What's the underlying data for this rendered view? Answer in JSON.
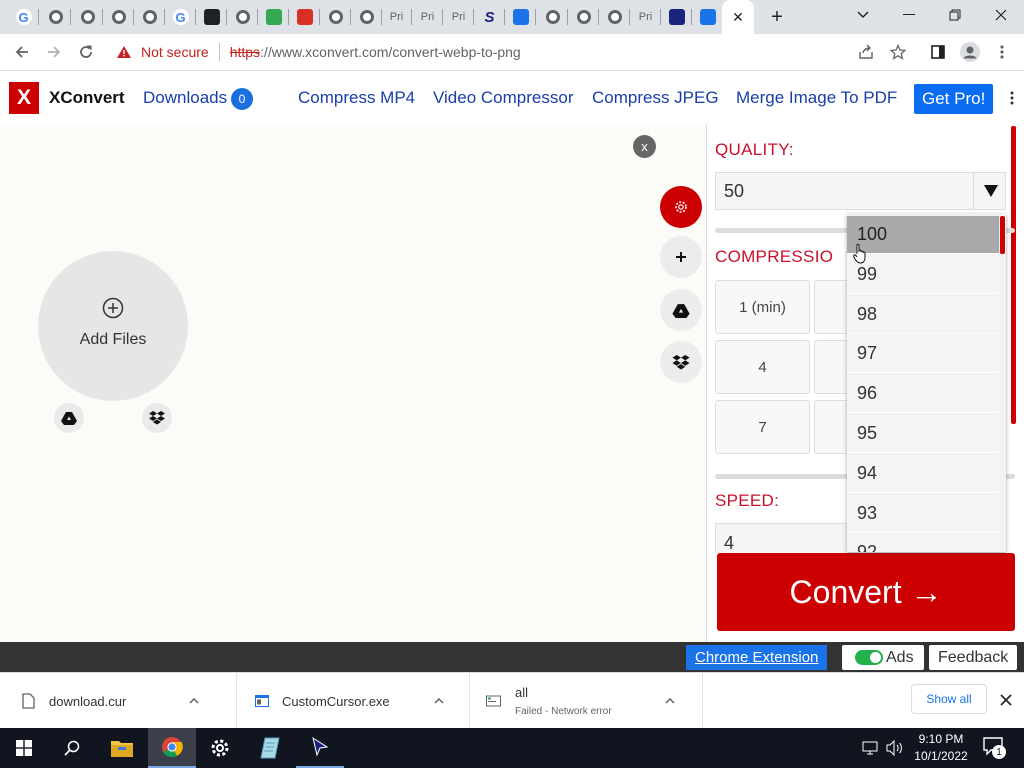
{
  "browser": {
    "tabs": [
      {
        "icon": "google-icon",
        "label": "G",
        "color": "#4285f4"
      },
      {
        "icon": "globe-icon",
        "label": "",
        "color": "#5f6368"
      },
      {
        "icon": "globe-icon",
        "label": "",
        "color": "#5f6368"
      },
      {
        "icon": "globe-icon",
        "label": "",
        "color": "#5f6368"
      },
      {
        "icon": "globe-icon",
        "label": "",
        "color": "#5f6368"
      },
      {
        "icon": "google-icon",
        "label": "G",
        "color": "#4285f4"
      },
      {
        "icon": "heart-icon",
        "label": "",
        "color": "#202124"
      },
      {
        "icon": "globe-icon",
        "label": "",
        "color": "#5f6368"
      },
      {
        "icon": "recycle-icon",
        "label": "",
        "color": "#34a853"
      },
      {
        "icon": "block-icon",
        "label": "",
        "color": "#d93025"
      },
      {
        "icon": "globe-icon",
        "label": "",
        "color": "#5f6368"
      },
      {
        "icon": "globe-icon",
        "label": "",
        "color": "#5f6368"
      },
      {
        "icon": "text-tab",
        "label": "Pri",
        "color": "#5f6368"
      },
      {
        "icon": "text-tab",
        "label": "Pri",
        "color": "#5f6368"
      },
      {
        "icon": "text-tab",
        "label": "Pri",
        "color": "#5f6368"
      },
      {
        "icon": "s-logo-icon",
        "label": "S",
        "color": "#1a237e"
      },
      {
        "icon": "cloud-download-icon",
        "label": "",
        "color": "#1a73e8"
      },
      {
        "icon": "globe-icon",
        "label": "",
        "color": "#5f6368"
      },
      {
        "icon": "globe-icon",
        "label": "",
        "color": "#5f6368"
      },
      {
        "icon": "globe-icon",
        "label": "",
        "color": "#5f6368"
      },
      {
        "icon": "text-tab",
        "label": "Pri",
        "color": "#5f6368"
      },
      {
        "icon": "cursor-icon",
        "label": "",
        "color": "#1a237e"
      },
      {
        "icon": "xconvert-tab-icon",
        "label": "",
        "color": "#1a73e8"
      }
    ],
    "close_tab": "✕",
    "new_tab": "+",
    "not_secure": "Not secure",
    "url_scheme": "https",
    "url_rest": "://www.xconvert.com/convert-webp-to-png"
  },
  "site": {
    "logo_letter": "X",
    "logo_name": "XConvert",
    "downloads_label": "Downloads",
    "downloads_count": "0",
    "nav": [
      "Compress MP4",
      "Video Compressor",
      "Compress JPEG",
      "Merge Image To PDF"
    ],
    "get_pro": "Get Pro!",
    "accent": "#cc0000",
    "link_color": "#1a3ea8"
  },
  "dropzone": {
    "close": "x",
    "add_files": "Add Files"
  },
  "panel": {
    "quality_label": "QUALITY:",
    "quality_value": "50",
    "compression_label": "COMPRESSIO",
    "compression_buttons": [
      "1 (min)",
      "",
      "4",
      "",
      "7",
      ""
    ],
    "speed_label": "SPEED:",
    "speed_value": "4",
    "convert_label": "Convert →"
  },
  "quality_dropdown": {
    "options": [
      "100",
      "99",
      "98",
      "97",
      "96",
      "95",
      "94",
      "93",
      "92"
    ],
    "selected": "100"
  },
  "footer": {
    "chrome_extension": "Chrome Extension",
    "ads": "Ads",
    "feedback": "Feedback"
  },
  "downloads_shelf": {
    "items": [
      {
        "name": "download.cur",
        "status": ""
      },
      {
        "name": "CustomCursor.exe",
        "status": ""
      },
      {
        "name": "all",
        "status": "Failed - Network error"
      }
    ],
    "show_all": "Show all"
  },
  "taskbar": {
    "time": "9:10 PM",
    "date": "10/1/2022",
    "notification_count": "1"
  }
}
